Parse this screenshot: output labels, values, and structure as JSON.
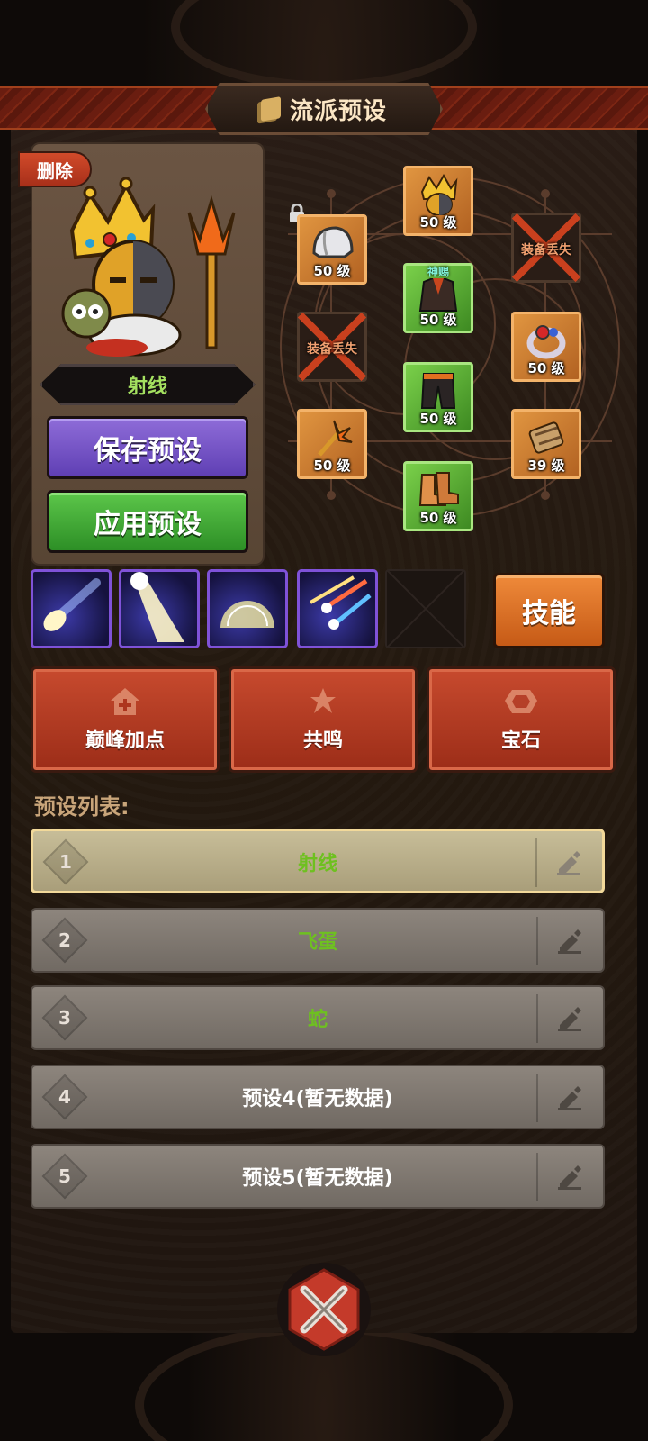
{
  "header": {
    "title": "流派预设"
  },
  "hero": {
    "delete_label": "删除",
    "preset_name": "射线"
  },
  "actions": {
    "save_label": "保存预设",
    "apply_label": "应用预设"
  },
  "equipment": {
    "helmet": {
      "level": "50 级",
      "locked": true
    },
    "crown": {
      "level": "50 级"
    },
    "slot_top_right": {
      "status": "装备丢失"
    },
    "armor": {
      "level": "50 级",
      "tag": "神赐"
    },
    "slot_mid_left": {
      "status": "装备丢失"
    },
    "ring": {
      "level": "50 级"
    },
    "pants": {
      "level": "50 级"
    },
    "weapon": {
      "level": "50 级"
    },
    "bracer": {
      "level": "39 级"
    },
    "boots": {
      "level": "50 级"
    }
  },
  "skills": {
    "button_label": "技能",
    "slot_names": [
      "comet-skill",
      "light-beam-skill",
      "dome-shield-skill",
      "meteor-shower-skill"
    ]
  },
  "features": [
    {
      "label": "巅峰加点",
      "icon": "house-plus-icon"
    },
    {
      "label": "共鸣",
      "icon": "star-burst-icon"
    },
    {
      "label": "宝石",
      "icon": "gem-icon"
    }
  ],
  "presets": {
    "title": "预设列表:",
    "items": [
      {
        "num": "1",
        "name": "射线"
      },
      {
        "num": "2",
        "name": "飞蛋"
      },
      {
        "num": "3",
        "name": "蛇"
      },
      {
        "num": "4",
        "name": "预设4(暂无数据)"
      },
      {
        "num": "5",
        "name": "预设5(暂无数据)"
      }
    ]
  },
  "colors": {
    "accent_green": "#6ec020",
    "accent_orange": "#c65a16",
    "panel_red": "#9c2d18"
  }
}
